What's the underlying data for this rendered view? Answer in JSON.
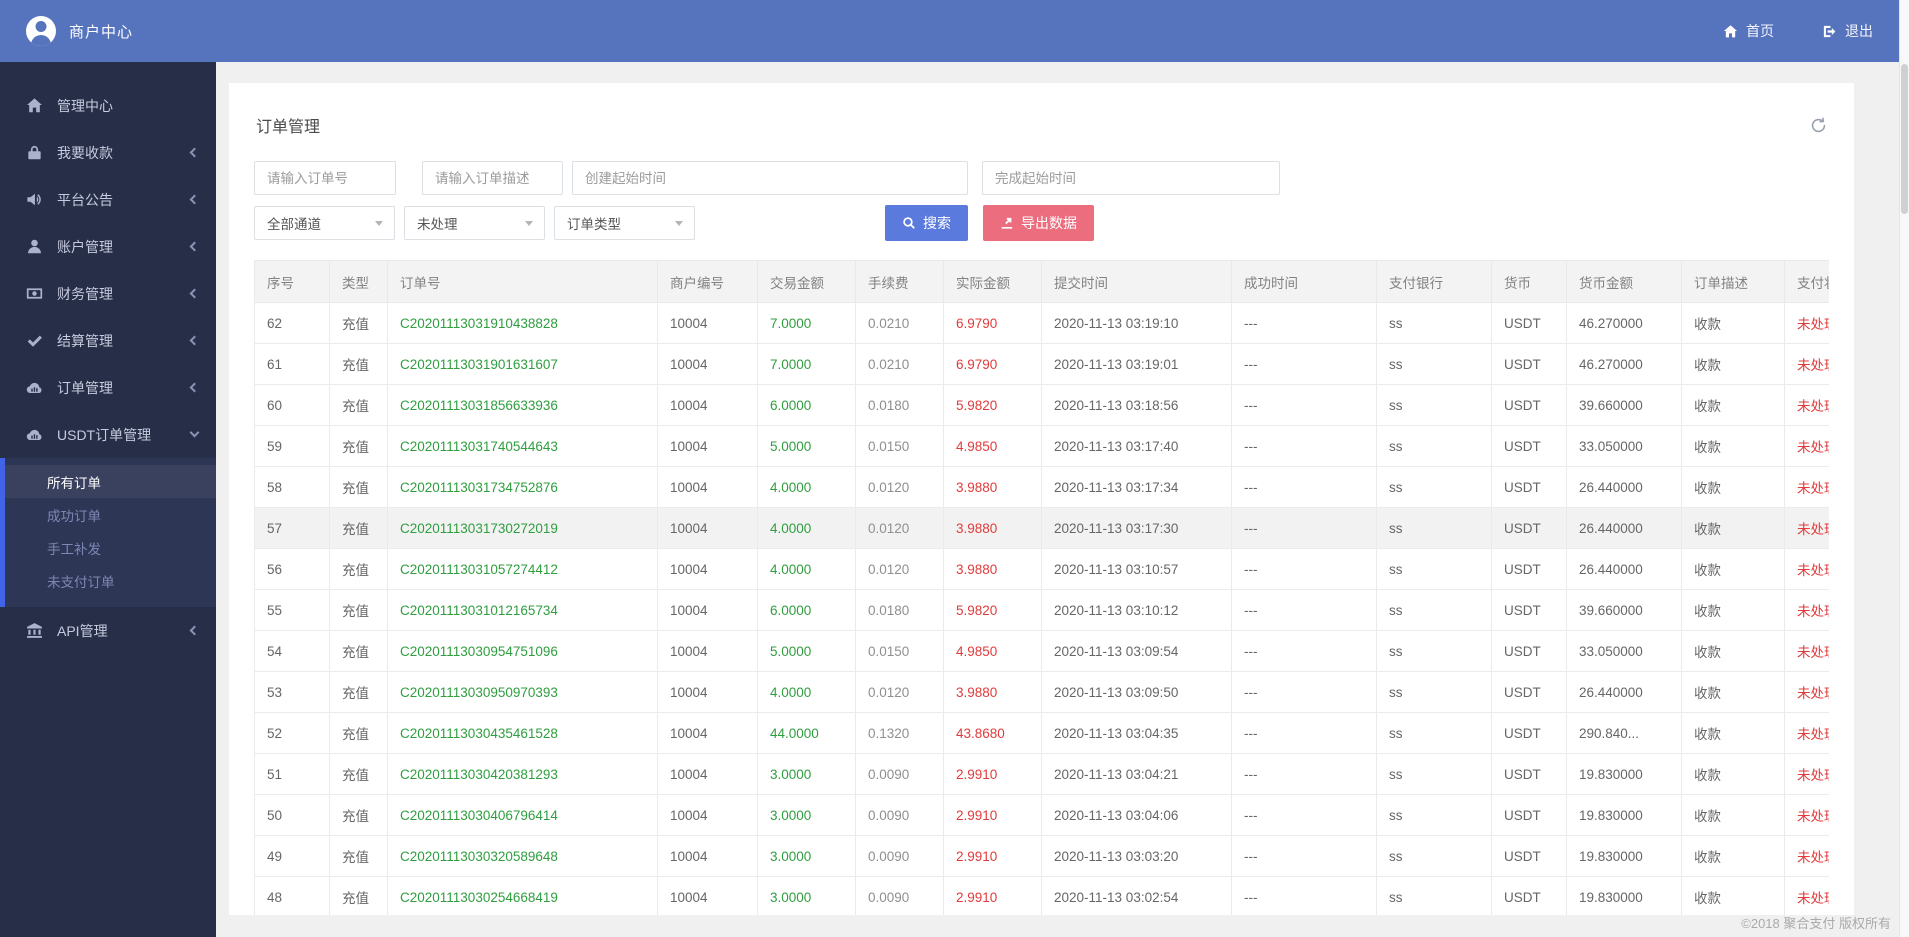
{
  "header": {
    "brand": "商户中心",
    "home_label": "首页",
    "logout_label": "退出"
  },
  "sidebar": {
    "items": [
      {
        "id": "admin-center",
        "label": "管理中心",
        "icon": "home-icon",
        "chevron": "none"
      },
      {
        "id": "collect",
        "label": "我要收款",
        "icon": "lock-icon",
        "chevron": "collapsed"
      },
      {
        "id": "announcement",
        "label": "平台公告",
        "icon": "speaker-icon",
        "chevron": "collapsed"
      },
      {
        "id": "account",
        "label": "账户管理",
        "icon": "user-icon",
        "chevron": "collapsed"
      },
      {
        "id": "finance",
        "label": "财务管理",
        "icon": "money-icon",
        "chevron": "collapsed"
      },
      {
        "id": "settlement",
        "label": "结算管理",
        "icon": "check-icon",
        "chevron": "collapsed"
      },
      {
        "id": "orders",
        "label": "订单管理",
        "icon": "cloud-chart-icon",
        "chevron": "collapsed"
      },
      {
        "id": "usdt-orders",
        "label": "USDT订单管理",
        "icon": "cloud-chart-icon",
        "chevron": "expanded",
        "children": [
          {
            "label": "所有订单",
            "active": true
          },
          {
            "label": "成功订单",
            "active": false
          },
          {
            "label": "手工补发",
            "active": false
          },
          {
            "label": "未支付订单",
            "active": false
          }
        ]
      },
      {
        "id": "api",
        "label": "API管理",
        "icon": "bank-icon",
        "chevron": "collapsed"
      }
    ]
  },
  "page": {
    "title": "订单管理"
  },
  "filters": {
    "order_no_placeholder": "请输入订单号",
    "order_desc_placeholder": "请输入订单描述",
    "create_time_placeholder": "创建起始时间",
    "finish_time_placeholder": "完成起始时间",
    "channel_select": "全部通道",
    "status_select": "未处理",
    "type_select": "订单类型",
    "search_label": "搜索",
    "export_label": "导出数据"
  },
  "table": {
    "columns": [
      "序号",
      "类型",
      "订单号",
      "商户编号",
      "交易金额",
      "手续费",
      "实际金额",
      "提交时间",
      "成功时间",
      "支付银行",
      "货币",
      "货币金额",
      "订单描述",
      "支付状态"
    ],
    "highlighted_seq": "57",
    "rows": [
      [
        "62",
        "充值",
        "C20201113031910438828",
        "10004",
        "7.0000",
        "0.0210",
        "6.9790",
        "2020-11-13 03:19:10",
        "---",
        "ss",
        "USDT",
        "46.270000",
        "收款",
        "未处理"
      ],
      [
        "61",
        "充值",
        "C20201113031901631607",
        "10004",
        "7.0000",
        "0.0210",
        "6.9790",
        "2020-11-13 03:19:01",
        "---",
        "ss",
        "USDT",
        "46.270000",
        "收款",
        "未处理"
      ],
      [
        "60",
        "充值",
        "C20201113031856633936",
        "10004",
        "6.0000",
        "0.0180",
        "5.9820",
        "2020-11-13 03:18:56",
        "---",
        "ss",
        "USDT",
        "39.660000",
        "收款",
        "未处理"
      ],
      [
        "59",
        "充值",
        "C20201113031740544643",
        "10004",
        "5.0000",
        "0.0150",
        "4.9850",
        "2020-11-13 03:17:40",
        "---",
        "ss",
        "USDT",
        "33.050000",
        "收款",
        "未处理"
      ],
      [
        "58",
        "充值",
        "C20201113031734752876",
        "10004",
        "4.0000",
        "0.0120",
        "3.9880",
        "2020-11-13 03:17:34",
        "---",
        "ss",
        "USDT",
        "26.440000",
        "收款",
        "未处理"
      ],
      [
        "57",
        "充值",
        "C20201113031730272019",
        "10004",
        "4.0000",
        "0.0120",
        "3.9880",
        "2020-11-13 03:17:30",
        "---",
        "ss",
        "USDT",
        "26.440000",
        "收款",
        "未处理"
      ],
      [
        "56",
        "充值",
        "C20201113031057274412",
        "10004",
        "4.0000",
        "0.0120",
        "3.9880",
        "2020-11-13 03:10:57",
        "---",
        "ss",
        "USDT",
        "26.440000",
        "收款",
        "未处理"
      ],
      [
        "55",
        "充值",
        "C20201113031012165734",
        "10004",
        "6.0000",
        "0.0180",
        "5.9820",
        "2020-11-13 03:10:12",
        "---",
        "ss",
        "USDT",
        "39.660000",
        "收款",
        "未处理"
      ],
      [
        "54",
        "充值",
        "C20201113030954751096",
        "10004",
        "5.0000",
        "0.0150",
        "4.9850",
        "2020-11-13 03:09:54",
        "---",
        "ss",
        "USDT",
        "33.050000",
        "收款",
        "未处理"
      ],
      [
        "53",
        "充值",
        "C20201113030950970393",
        "10004",
        "4.0000",
        "0.0120",
        "3.9880",
        "2020-11-13 03:09:50",
        "---",
        "ss",
        "USDT",
        "26.440000",
        "收款",
        "未处理"
      ],
      [
        "52",
        "充值",
        "C20201113030435461528",
        "10004",
        "44.0000",
        "0.1320",
        "43.8680",
        "2020-11-13 03:04:35",
        "---",
        "ss",
        "USDT",
        "290.840...",
        "收款",
        "未处理"
      ],
      [
        "51",
        "充值",
        "C20201113030420381293",
        "10004",
        "3.0000",
        "0.0090",
        "2.9910",
        "2020-11-13 03:04:21",
        "---",
        "ss",
        "USDT",
        "19.830000",
        "收款",
        "未处理"
      ],
      [
        "50",
        "充值",
        "C20201113030406796414",
        "10004",
        "3.0000",
        "0.0090",
        "2.9910",
        "2020-11-13 03:04:06",
        "---",
        "ss",
        "USDT",
        "19.830000",
        "收款",
        "未处理"
      ],
      [
        "49",
        "充值",
        "C20201113030320589648",
        "10004",
        "3.0000",
        "0.0090",
        "2.9910",
        "2020-11-13 03:03:20",
        "---",
        "ss",
        "USDT",
        "19.830000",
        "收款",
        "未处理"
      ],
      [
        "48",
        "充值",
        "C20201113030254668419",
        "10004",
        "3.0000",
        "0.0090",
        "2.9910",
        "2020-11-13 03:02:54",
        "---",
        "ss",
        "USDT",
        "19.830000",
        "收款",
        "未处理"
      ]
    ]
  },
  "footer": {
    "copyright": "©2018 聚合支付 版权所有"
  },
  "colors": {
    "topbar": "#5673bd",
    "sidebar": "#272e47",
    "submenu_bar": "#4063e8",
    "search_button": "#5b7ade",
    "export_button": "#ec6d7d",
    "amount_green": "#2f9e3f",
    "amount_red": "#e13b3b"
  }
}
